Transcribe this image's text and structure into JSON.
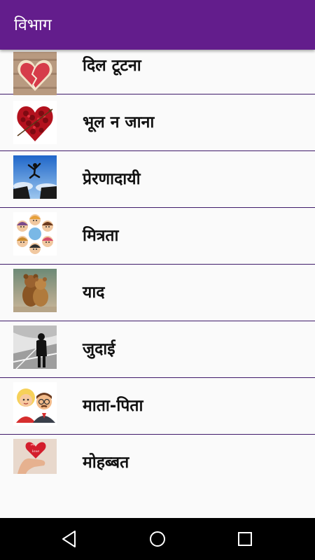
{
  "app_bar": {
    "title": "विभाग"
  },
  "categories": [
    {
      "label": "दिल टूटना",
      "icon": "broken-heart-cookie-icon"
    },
    {
      "label": "भूल न जाना",
      "icon": "rose-heart-icon"
    },
    {
      "label": "प्रेरणादायी",
      "icon": "jumping-man-icon"
    },
    {
      "label": "मित्रता",
      "icon": "friends-circle-icon"
    },
    {
      "label": "याद",
      "icon": "hugging-bears-icon"
    },
    {
      "label": "जुदाई",
      "icon": "lonely-man-icon"
    },
    {
      "label": "माता-पिता",
      "icon": "cartoon-couple-icon"
    },
    {
      "label": "मोहब्बत",
      "icon": "heart-in-hand-icon"
    }
  ],
  "nav_bar": {
    "back": "back-triangle-icon",
    "home": "home-circle-icon",
    "recents": "recents-square-icon"
  }
}
